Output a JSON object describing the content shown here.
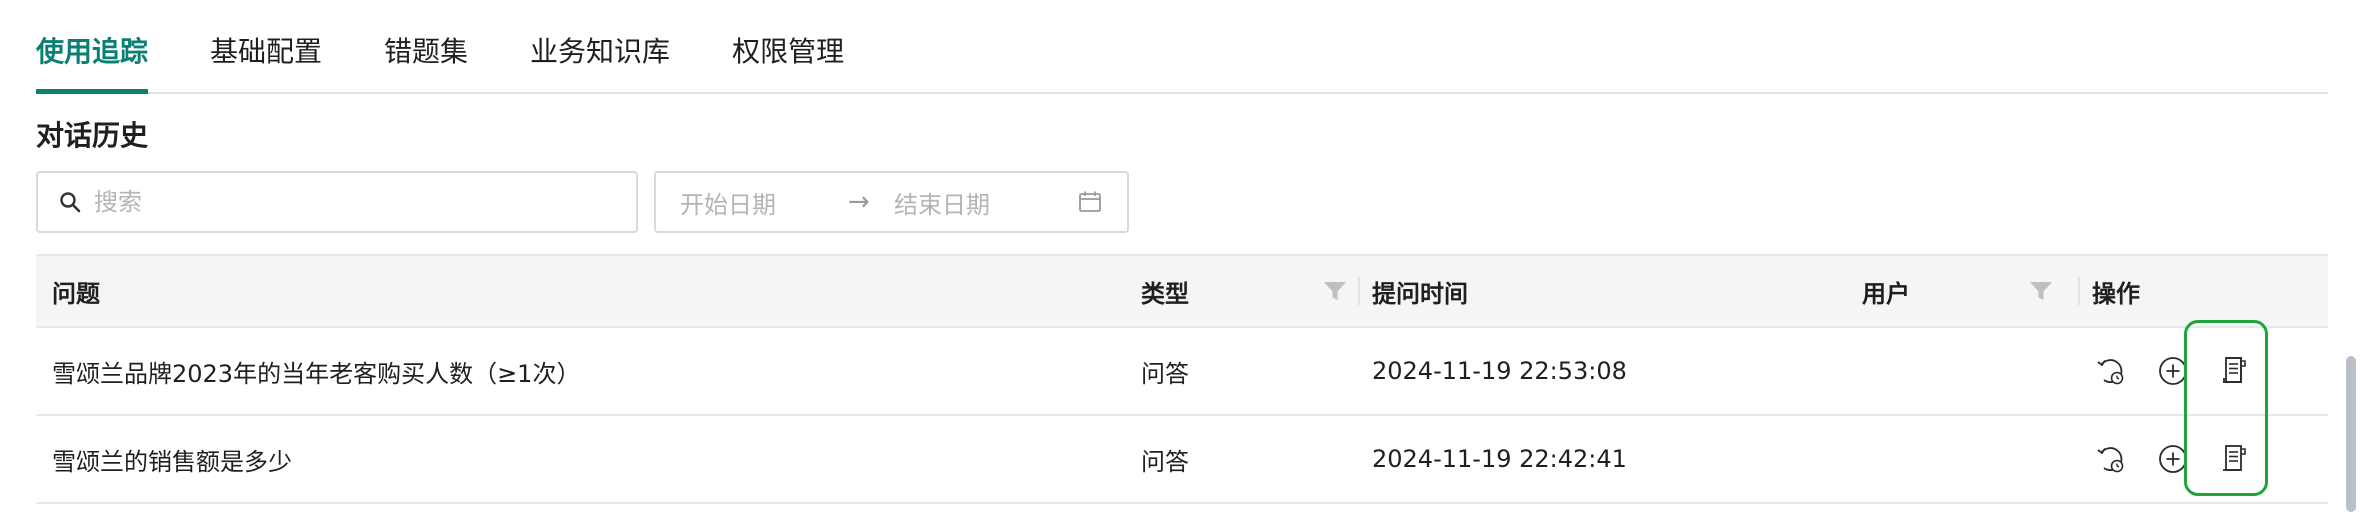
{
  "tabs": [
    {
      "label": "使用追踪",
      "active": true
    },
    {
      "label": "基础配置",
      "active": false
    },
    {
      "label": "错题集",
      "active": false
    },
    {
      "label": "业务知识库",
      "active": false
    },
    {
      "label": "权限管理",
      "active": false
    }
  ],
  "section_title": "对话历史",
  "search": {
    "placeholder": "搜索",
    "value": ""
  },
  "date_range": {
    "start_placeholder": "开始日期",
    "separator": "→",
    "end_placeholder": "结束日期"
  },
  "table": {
    "headers": {
      "question": "问题",
      "type": "类型",
      "time": "提问时间",
      "user": "用户",
      "ops": "操作"
    },
    "rows": [
      {
        "question": "雪颂兰品牌2023年的当年老客购买人数（≥1次）",
        "type": "问答",
        "time": "2024-11-19 22:53:08",
        "user": ""
      },
      {
        "question": "雪颂兰的销售额是多少",
        "type": "问答",
        "time": "2024-11-19 22:42:41",
        "user": ""
      }
    ]
  },
  "icons": {
    "search": "search-icon",
    "calendar": "calendar-icon",
    "filter": "filter-icon",
    "rerun": "rerun-clock-icon",
    "add": "add-circle-icon",
    "log": "document-log-icon"
  },
  "colors": {
    "accent": "#0a7f73",
    "highlight": "#1fa33a"
  }
}
